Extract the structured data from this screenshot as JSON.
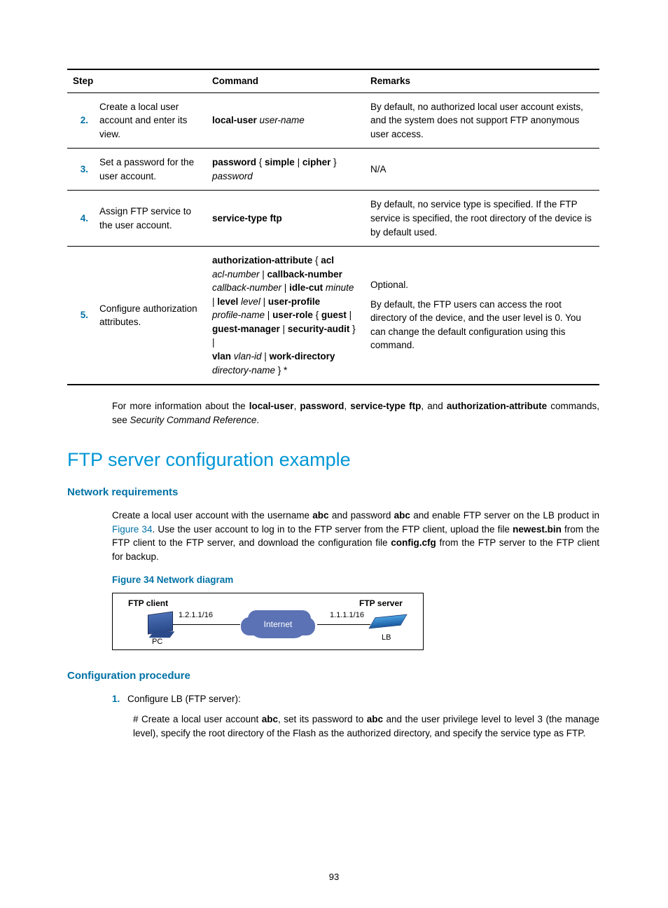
{
  "table": {
    "headers": {
      "step": "Step",
      "command": "Command",
      "remarks": "Remarks"
    },
    "rows": [
      {
        "num": "2.",
        "step": "Create a local user account and enter its view.",
        "cmd_b1": "local-user",
        "cmd_i1": " user-name",
        "remarks": "By default, no authorized local user account exists, and the system does not support FTP anonymous user access."
      },
      {
        "num": "3.",
        "step": "Set a password for the user account.",
        "cmd_b1": "password",
        "cmd_t1": " { ",
        "cmd_b2": "simple",
        "cmd_t2": " | ",
        "cmd_b3": "cipher",
        "cmd_t3": " } ",
        "cmd_i1": "password",
        "remarks": "N/A"
      },
      {
        "num": "4.",
        "step": "Assign FTP service to the user account.",
        "cmd_b1": "service-type ftp",
        "remarks": "By default, no service type is specified. If the FTP service is specified, the root directory of the device is by default used."
      },
      {
        "num": "5.",
        "step": "Configure authorization attributes.",
        "cmd_b1": "authorization-attribute",
        "cmd_t1": " { ",
        "cmd_b2": "acl",
        "cmd_i1": " acl-number",
        "cmd_t2": " | ",
        "cmd_b3": "callback-number",
        "cmd_i2": " callback-number",
        "cmd_t3": " | ",
        "cmd_b4": "idle-cut",
        "cmd_i3": " minute",
        "cmd_t4": " | ",
        "cmd_b5": "level",
        "cmd_i4": " level",
        "cmd_t5": " | ",
        "cmd_b6": "user-profile",
        "cmd_i5": " profile-name",
        "cmd_t6": " | ",
        "cmd_b7": "user-role",
        "cmd_t7": " { ",
        "cmd_b8": "guest",
        "cmd_t8": " | ",
        "cmd_b9": "guest-manager",
        "cmd_t9": " | ",
        "cmd_b10": "security-audit",
        "cmd_t10": " } | ",
        "cmd_b11": "vlan",
        "cmd_i6": " vlan-id",
        "cmd_t11": " | ",
        "cmd_b12": "work-directory",
        "cmd_i7": " directory-name",
        "cmd_t12": " } *",
        "rem_p1": "Optional.",
        "rem_p2": "By default, the FTP users can access the root directory of the device, and the user level is 0. You can change the default configuration using this command."
      }
    ]
  },
  "after_table": {
    "p1a": "For more information about the ",
    "b1": "local-user",
    "p1b": ", ",
    "b2": "password",
    "p1c": ", ",
    "b3": "service-type ftp",
    "p1d": ", and ",
    "b4": "authorization-attribute",
    "p1e": " commands, see ",
    "i1": "Security Command Reference",
    "p1f": "."
  },
  "h1": "FTP server configuration example",
  "h2a": "Network requirements",
  "netreq": {
    "a": "Create a local user account with the username ",
    "b1": "abc",
    "b": " and password ",
    "b2": "abc",
    "c": " and enable FTP server on the LB product in ",
    "link": "Figure 34",
    "d": ". Use the user account to log in to the FTP server from the FTP client, upload the file ",
    "b3": "newest.bin",
    "e": " from the FTP client to the FTP server, and download the configuration file ",
    "b4": "config.cfg",
    "f": " from the FTP server to the FTP client for backup."
  },
  "fig_caption": "Figure 34 Network diagram",
  "diagram": {
    "ftp_client": "FTP client",
    "ftp_server": "FTP server",
    "ip_client": "1.2.1.1/16",
    "ip_server": "1.1.1.1/16",
    "internet": "Internet",
    "pc": "PC",
    "lb": "LB"
  },
  "h2b": "Configuration procedure",
  "proc": {
    "num": "1.",
    "step": "Configure LB (FTP server):",
    "para_a": "# Create a local user account ",
    "b1": "abc",
    "para_b": ", set its password to ",
    "b2": "abc",
    "para_c": " and the user privilege level to level 3 (the manage level), specify the root directory of the Flash as the authorized directory, and specify the service type as FTP."
  },
  "page_number": "93"
}
